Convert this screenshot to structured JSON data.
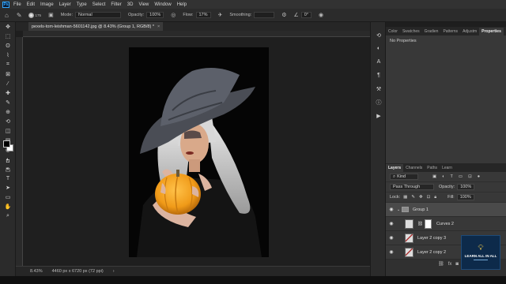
{
  "menubar": {
    "app_icon": "Ps",
    "items": [
      "File",
      "Edit",
      "Image",
      "Layer",
      "Type",
      "Select",
      "Filter",
      "3D",
      "View",
      "Window",
      "Help"
    ]
  },
  "options_bar": {
    "brush_size": "175",
    "mode_label": "Mode:",
    "mode_value": "Normal",
    "opacity_label": "Opacity:",
    "opacity_value": "100%",
    "flow_label": "Flow:",
    "flow_value": "17%",
    "smoothing_label": "Smoothing:",
    "angle_value": "0°"
  },
  "document": {
    "tab_title": "pexels-tom-leishman-5601142.jpg @ 8.43% (Group 1, RGB/8) *",
    "close_glyph": "×"
  },
  "status_bar": {
    "zoom": "8.43%",
    "dimensions": "4460 px x 6720 px (72 ppi)"
  },
  "toolbar": {
    "icons": [
      "move-icon",
      "marquee-icon",
      "lasso-icon",
      "quick-select-icon",
      "crop-icon",
      "frame-icon",
      "eyedropper-icon",
      "healing-icon",
      "brush-icon",
      "stamp-icon",
      "history-brush-icon",
      "eraser-icon",
      "gradient-icon",
      "blur-icon",
      "dodge-icon",
      "pen-icon",
      "type-icon",
      "path-select-icon",
      "rectangle-icon",
      "hand-icon",
      "zoom-icon"
    ],
    "glyphs": [
      "✥",
      "⬚",
      "ʘ",
      "⌇",
      "⌗",
      "⊠",
      "⁄",
      "✚",
      "✎",
      "⊕",
      "⟲",
      "◫",
      "▤",
      "◍",
      "◐",
      "✒",
      "T",
      "➤",
      "▭",
      "✋",
      "⌕"
    ]
  },
  "properties_panel": {
    "tabs": [
      "Color",
      "Swatches",
      "Gradien",
      "Patterns",
      "Adjustm",
      "Properties"
    ],
    "active_tab": "Properties",
    "body_text": "No Properties"
  },
  "layers_panel": {
    "tabs": [
      "Layers",
      "Channels",
      "Paths",
      "Learn"
    ],
    "active_tab": "Layers",
    "filter_value": "Kind",
    "blend_mode": "Pass Through",
    "opacity_label": "Opacity:",
    "opacity_value": "100%",
    "lock_label": "Lock:",
    "fill_label": "Fill:",
    "fill_value": "100%",
    "layers": [
      {
        "name": "Group 1",
        "type": "group",
        "selected": true
      },
      {
        "name": "Curves 2",
        "type": "adjustment",
        "selected": false
      },
      {
        "name": "Layer 2 copy 3",
        "type": "pixel",
        "selected": false
      },
      {
        "name": "Layer 2 copy 2",
        "type": "pixel",
        "selected": false
      }
    ]
  },
  "watermark": {
    "title": "LEARN ALL IN ALL"
  },
  "colors": {
    "accent": "#31a8ff",
    "pumpkin": "#f0a020"
  }
}
